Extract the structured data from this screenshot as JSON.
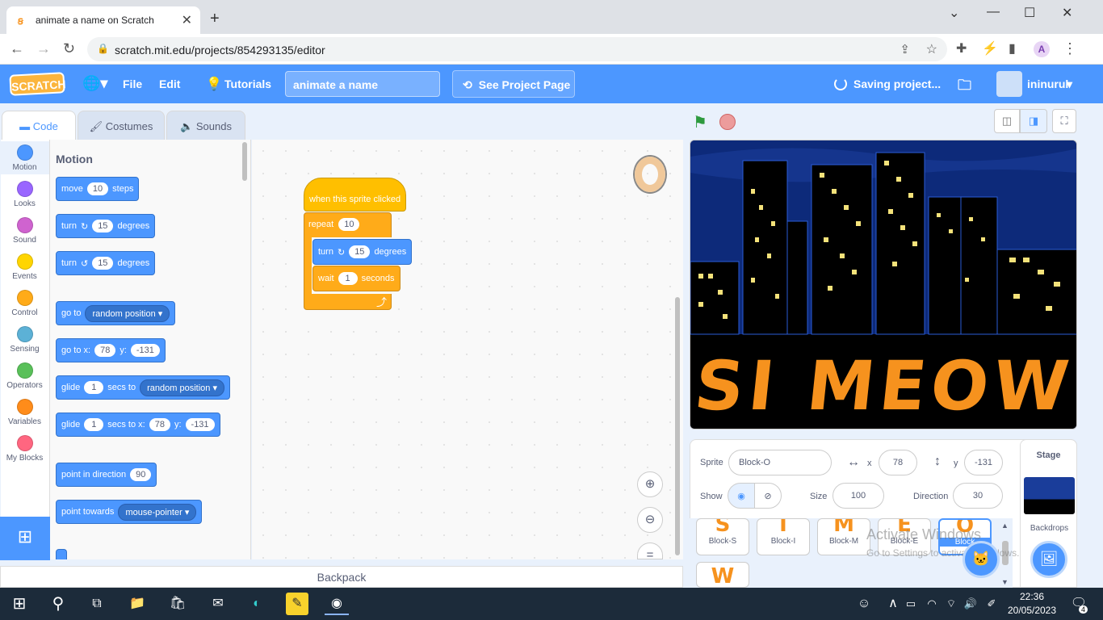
{
  "browser": {
    "tab_title": "animate a name on Scratch",
    "url": "scratch.mit.edu/projects/854293135/editor",
    "profile_initial": "A"
  },
  "menu": {
    "logo": "SCRATCH",
    "file": "File",
    "edit": "Edit",
    "tutorials": "Tutorials",
    "project_title": "animate a name",
    "see_project": "See Project Page",
    "saving": "Saving project...",
    "username": "ininurul"
  },
  "tabs": {
    "code": "Code",
    "costumes": "Costumes",
    "sounds": "Sounds"
  },
  "categories": [
    {
      "label": "Motion",
      "color": "#4c97ff"
    },
    {
      "label": "Looks",
      "color": "#9966ff"
    },
    {
      "label": "Sound",
      "color": "#cf63cf"
    },
    {
      "label": "Events",
      "color": "#ffd500"
    },
    {
      "label": "Control",
      "color": "#ffab19"
    },
    {
      "label": "Sensing",
      "color": "#5cb1d6"
    },
    {
      "label": "Operators",
      "color": "#59c059"
    },
    {
      "label": "Variables",
      "color": "#ff8c1a"
    },
    {
      "label": "My Blocks",
      "color": "#ff6680"
    }
  ],
  "palette": {
    "heading": "Motion",
    "move": "move",
    "move_n": "10",
    "steps": "steps",
    "turn": "turn",
    "turn_n": "15",
    "degrees": "degrees",
    "goto": "go to",
    "random_position": "random position",
    "goto_x": "go to x:",
    "x_val": "78",
    "y_label": "y:",
    "y_val": "-131",
    "glide": "glide",
    "glide_n": "1",
    "secs_to": "secs to",
    "secs_to_x": "secs to x:",
    "point_dir": "point in direction",
    "dir_val": "90",
    "point_towards": "point towards",
    "mouse_pointer": "mouse-pointer"
  },
  "script": {
    "hat": "when this sprite clicked",
    "repeat": "repeat",
    "repeat_n": "10",
    "turn": "turn",
    "turn_n": "15",
    "degrees": "degrees",
    "wait": "wait",
    "wait_n": "1",
    "seconds": "seconds"
  },
  "stage": {
    "text": "SI MEOW"
  },
  "sprite_info": {
    "sprite_label": "Sprite",
    "sprite_name": "Block-O",
    "x_label": "x",
    "x": "78",
    "y_label": "y",
    "y": "-131",
    "show_label": "Show",
    "size_label": "Size",
    "size": "100",
    "direction_label": "Direction",
    "direction": "30"
  },
  "sprites": [
    {
      "name": "Block-S",
      "glyph": "S"
    },
    {
      "name": "Block-I",
      "glyph": "I"
    },
    {
      "name": "Block-M",
      "glyph": "M"
    },
    {
      "name": "Block-E",
      "glyph": "E"
    },
    {
      "name": "Block",
      "glyph": "O"
    },
    {
      "name": "",
      "glyph": "W"
    }
  ],
  "stage_pane": {
    "title": "Stage",
    "backdrops": "Backdrops"
  },
  "backpack": "Backpack",
  "watermark": {
    "line1": "Activate Windows",
    "line2": "Go to Settings to activate Windows."
  },
  "taskbar": {
    "time": "22:36",
    "date": "20/05/2023",
    "notifications": "4"
  }
}
